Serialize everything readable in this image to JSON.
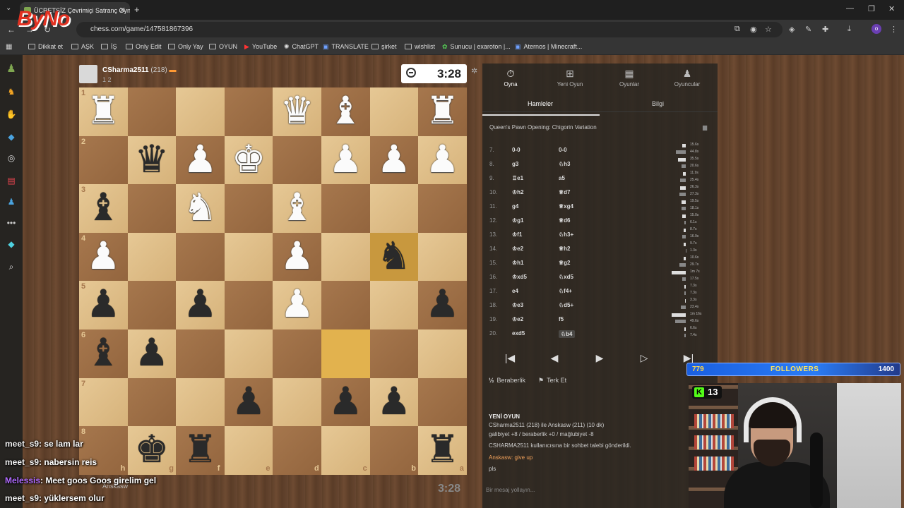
{
  "browser": {
    "tab_title": "ÜCRETSİZ Çevrimiçi Satranç Oyna",
    "url": "chess.com/game/147581867396",
    "profile_initial": "o",
    "bookmarks": [
      "Dikkat et",
      "AŞK",
      "İŞ",
      "Only Edit",
      "Only Yay",
      "OYUN",
      "YouTube",
      "ChatGPT",
      "TRANSLATE",
      "şirket",
      "wishlist",
      "Sunucu | exaroton |...",
      "Aternos | Minecraft..."
    ]
  },
  "overlay": {
    "logo": "ByNo",
    "followers": {
      "current": "779",
      "label": "FOLLOWERS",
      "goal": "1400",
      "progress_fraction": 0.556
    },
    "kick_viewers": "13",
    "chat": [
      {
        "user": "meet_s9",
        "text": ": se lam lar"
      },
      {
        "user": "meet_s9",
        "text": ": nabersin reis"
      },
      {
        "user": "Melessis",
        "text": ": Meet goos Goos girelim gel"
      },
      {
        "user": "meet_s9",
        "text": ": yüklersem olur"
      }
    ]
  },
  "game": {
    "opponent": {
      "name": "CSharma2511",
      "rating": "(218)",
      "score": "1 2"
    },
    "opponent_clock": "3:28",
    "player_clock": "3:28",
    "player_name": "Anskasw",
    "ranks": [
      "1",
      "2",
      "3",
      "4",
      "5",
      "6",
      "7",
      "8"
    ],
    "files": [
      "h",
      "g",
      "f",
      "e",
      "d",
      "c",
      "b",
      "a"
    ],
    "board": [
      [
        "wR",
        "",
        "",
        "",
        "wQ",
        "wB",
        "",
        "wR"
      ],
      [
        "",
        "bQ",
        "wP",
        "wK",
        "",
        "wP",
        "wP",
        "wP"
      ],
      [
        "bB",
        "",
        "wN",
        "",
        "wB",
        "",
        "",
        ""
      ],
      [
        "wP",
        "",
        "",
        "",
        "wP",
        "",
        "bN",
        ""
      ],
      [
        "bP",
        "",
        "bP",
        "",
        "wP",
        "",
        "",
        "bP"
      ],
      [
        "bB",
        "bP",
        "",
        "",
        "",
        "",
        "",
        ""
      ],
      [
        "",
        "",
        "",
        "bP",
        "",
        "bP",
        "bP",
        ""
      ],
      [
        "",
        "bK",
        "bR",
        "",
        "",
        "",
        "",
        "bR"
      ]
    ],
    "highlight": [
      [
        3,
        6
      ],
      [
        5,
        5
      ]
    ]
  },
  "panel": {
    "tabs": [
      {
        "label": "Oyna",
        "icon": "stopwatch-icon"
      },
      {
        "label": "Yeni Oyun",
        "icon": "plus-icon"
      },
      {
        "label": "Oyunlar",
        "icon": "board-icon"
      },
      {
        "label": "Oyuncular",
        "icon": "players-icon"
      }
    ],
    "subtabs": [
      "Hamleler",
      "Bilgi"
    ],
    "opening": "Queen's Pawn Opening: Chigorin Variation",
    "moves": [
      {
        "n": "7.",
        "w": "0-0",
        "b": "0-0",
        "tw": "15.6s",
        "tb": "44.8s",
        "ww": 0.25,
        "wb": 0.7
      },
      {
        "n": "8.",
        "w": "g3",
        "b": "♘h3",
        "tw": "35.5s",
        "tb": "20.6s",
        "ww": 0.55,
        "wb": 0.32
      },
      {
        "n": "9.",
        "w": "♖e1",
        "b": "a5",
        "tw": "11.9s",
        "tb": "25.4s",
        "ww": 0.19,
        "wb": 0.4
      },
      {
        "n": "10.",
        "w": "♔h2",
        "b": "♕d7",
        "tw": "26.3s",
        "tb": "27.3s",
        "ww": 0.41,
        "wb": 0.43
      },
      {
        "n": "11.",
        "w": "g4",
        "b": "♕xg4",
        "tw": "19.5s",
        "tb": "18.1s",
        "ww": 0.3,
        "wb": 0.28
      },
      {
        "n": "12.",
        "w": "♔g1",
        "b": "♕d6",
        "tw": "15.0s",
        "tb": "6.1s",
        "ww": 0.23,
        "wb": 0.1
      },
      {
        "n": "13.",
        "w": "♔f1",
        "b": "♘h3+",
        "tw": "8.7s",
        "tb": "16.9s",
        "ww": 0.14,
        "wb": 0.26
      },
      {
        "n": "14.",
        "w": "♔e2",
        "b": "♕h2",
        "tw": "9.7s",
        "tb": "1.3s",
        "ww": 0.15,
        "wb": 0.02
      },
      {
        "n": "15.",
        "w": "♔h1",
        "b": "♕g2",
        "tw": "10.6s",
        "tb": "29.7s",
        "ww": 0.17,
        "wb": 0.46
      },
      {
        "n": "16.",
        "w": "♔xd5",
        "b": "♘xd5",
        "tw": "1m 7s",
        "tb": "17.5s",
        "ww": 1.0,
        "wb": 0.27
      },
      {
        "n": "17.",
        "w": "e4",
        "b": "♘f4+",
        "tw": "7.3s",
        "tb": "7.3s",
        "ww": 0.11,
        "wb": 0.11
      },
      {
        "n": "18.",
        "w": "♔e3",
        "b": "♘d5+",
        "tw": "3.3s",
        "tb": "23.4s",
        "ww": 0.05,
        "wb": 0.36
      },
      {
        "n": "19.",
        "w": "♔e2",
        "b": "f5",
        "tw": "1m 16s",
        "tb": "49.6s",
        "ww": 1.0,
        "wb": 0.77
      },
      {
        "n": "20.",
        "w": "exd5",
        "b": "♘b4",
        "tw": "6.6s",
        "tb": "7.4s",
        "ww": 0.1,
        "wb": 0.11
      }
    ],
    "draw_label": "Beraberlik",
    "resign_label": "Terk Et",
    "new_game_title": "YENİ OYUN",
    "new_game_lines": [
      "CSharma2511 (218) ile Anskasw (211) (10 dk)",
      "galibiyet +8 / beraberlik +0 / mağlubiyet -8",
      "CSHARMA2511 kullanıcısına bir sohbet talebi gönderildi.",
      "Anskasw: give up",
      "pls"
    ],
    "chat_placeholder": "Bir mesaj yollayın..."
  }
}
